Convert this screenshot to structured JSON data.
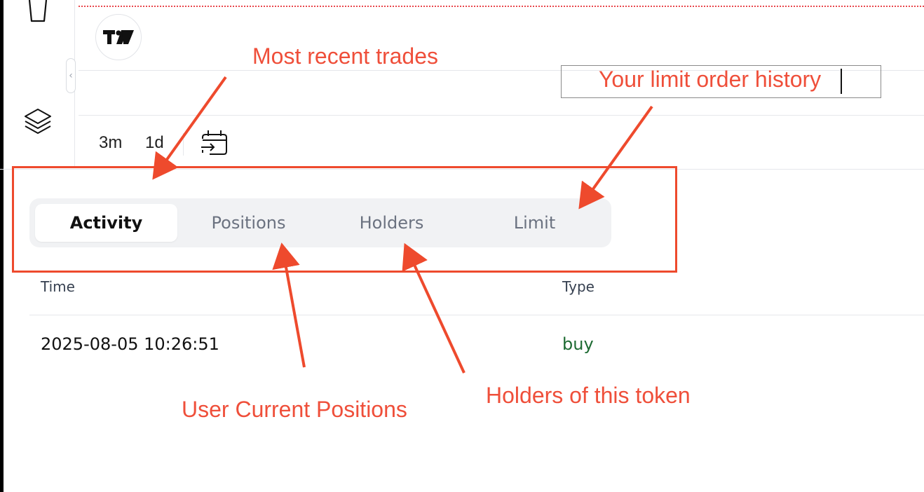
{
  "toolbar": {
    "top_icon": "cup-icon",
    "layers_icon": "layers-icon",
    "collapse_icon": "chevron-left-icon",
    "collapse_glyph": "‹"
  },
  "chart": {
    "logo_icon": "tradingview-logo-icon",
    "timeframes": [
      "3m",
      "1d"
    ],
    "date_range_icon": "calendar-range-icon"
  },
  "tabs": [
    {
      "label": "Activity",
      "active": true
    },
    {
      "label": "Positions",
      "active": false
    },
    {
      "label": "Holders",
      "active": false
    },
    {
      "label": "Limit",
      "active": false
    }
  ],
  "table": {
    "headers": [
      "Time",
      "Type"
    ],
    "rows": [
      {
        "time": "2025-08-05 10:26:51",
        "type": "buy"
      }
    ]
  },
  "annotations": {
    "recent_trades": "Most recent trades",
    "limit_history": "Your limit order history",
    "positions": "User Current Positions",
    "holders": "Holders of this token"
  },
  "colors": {
    "annotation": "#ef4f3a",
    "buy": "#1d6a32",
    "tab_bg": "#f1f2f4"
  }
}
